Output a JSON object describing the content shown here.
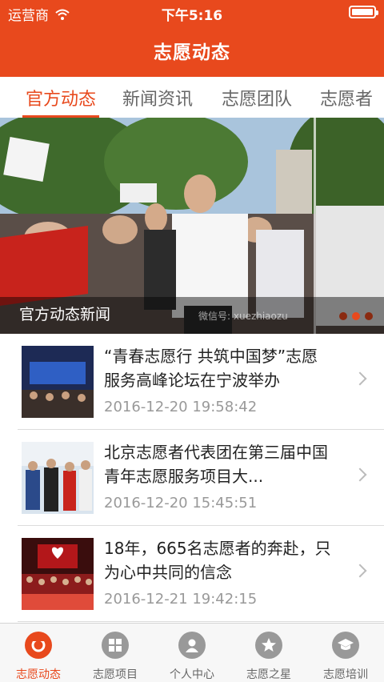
{
  "status_bar": {
    "carrier": "运营商",
    "time": "下午5:16",
    "battery_level": 1.0
  },
  "nav": {
    "title": "志愿动态"
  },
  "tabs": [
    {
      "label": "官方动态",
      "active": true
    },
    {
      "label": "新闻资讯",
      "active": false
    },
    {
      "label": "志愿团队",
      "active": false
    },
    {
      "label": "志愿者",
      "active": false
    }
  ],
  "banner": {
    "caption": "官方动态新闻",
    "watermark": "微信号: xuezhiaozu",
    "slide_count": 3,
    "active_slide": 1
  },
  "news": [
    {
      "title": "“青春志愿行 共筑中国梦”志愿服务高峰论坛在宁波举办",
      "date": "2016-12-20 19:58:42"
    },
    {
      "title": "北京志愿者代表团在第三届中国青年志愿服务项目大...",
      "date": "2016-12-20 15:45:51"
    },
    {
      "title": "18年，665名志愿者的奔赴，只为心中共同的信念",
      "date": "2016-12-21 19:42:15"
    }
  ],
  "tabbar": [
    {
      "label": "志愿动态",
      "icon": "volunteer-news-icon",
      "active": true
    },
    {
      "label": "志愿项目",
      "icon": "grid-icon",
      "active": false
    },
    {
      "label": "个人中心",
      "icon": "user-icon",
      "active": false
    },
    {
      "label": "志愿之星",
      "icon": "star-icon",
      "active": false
    },
    {
      "label": "志愿培训",
      "icon": "graduation-cap-icon",
      "active": false
    }
  ],
  "colors": {
    "accent": "#e8491d",
    "inactive": "#999999"
  }
}
